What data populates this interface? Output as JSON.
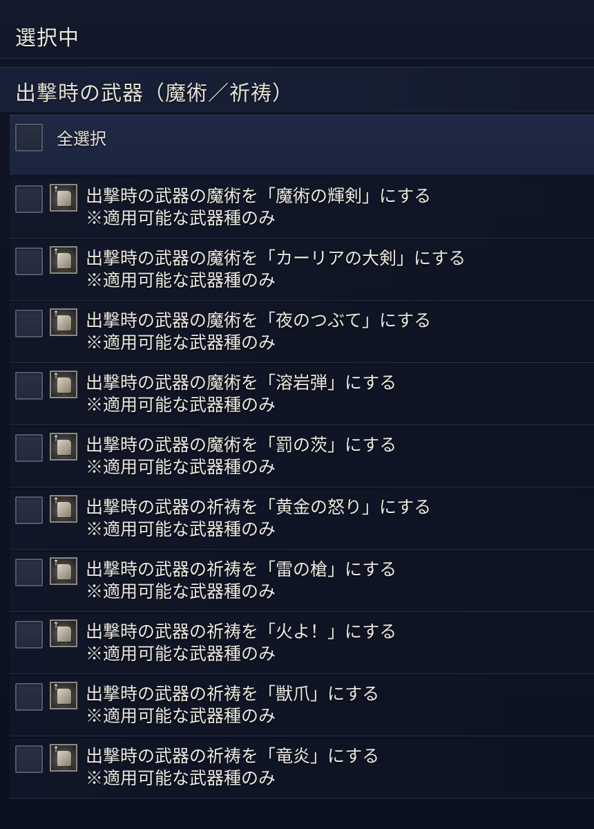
{
  "header": {
    "title": "選択中"
  },
  "section": {
    "title": "出撃時の武器（魔術／祈祷）"
  },
  "select_all": {
    "label": "全選択"
  },
  "items": [
    {
      "label": "出撃時の武器の魔術を「魔術の輝剣」にする",
      "note": "※適用可能な武器種のみ"
    },
    {
      "label": "出撃時の武器の魔術を「カーリアの大剣」にする",
      "note": "※適用可能な武器種のみ"
    },
    {
      "label": "出撃時の武器の魔術を「夜のつぶて」にする",
      "note": "※適用可能な武器種のみ"
    },
    {
      "label": "出撃時の武器の魔術を「溶岩弾」にする",
      "note": "※適用可能な武器種のみ"
    },
    {
      "label": "出撃時の武器の魔術を「罰の茨」にする",
      "note": "※適用可能な武器種のみ"
    },
    {
      "label": "出撃時の武器の祈祷を「黄金の怒り」にする",
      "note": "※適用可能な武器種のみ"
    },
    {
      "label": "出撃時の武器の祈祷を「雷の槍」にする",
      "note": "※適用可能な武器種のみ"
    },
    {
      "label": "出撃時の武器の祈祷を「火よ！」にする",
      "note": "※適用可能な武器種のみ"
    },
    {
      "label": "出撃時の武器の祈祷を「獣爪」にする",
      "note": "※適用可能な武器種のみ"
    },
    {
      "label": "出撃時の武器の祈祷を「竜炎」にする",
      "note": "※適用可能な武器種のみ"
    }
  ],
  "icons": {
    "item": "scroll-upgrade-icon",
    "arrow": "up-arrow-icon"
  }
}
